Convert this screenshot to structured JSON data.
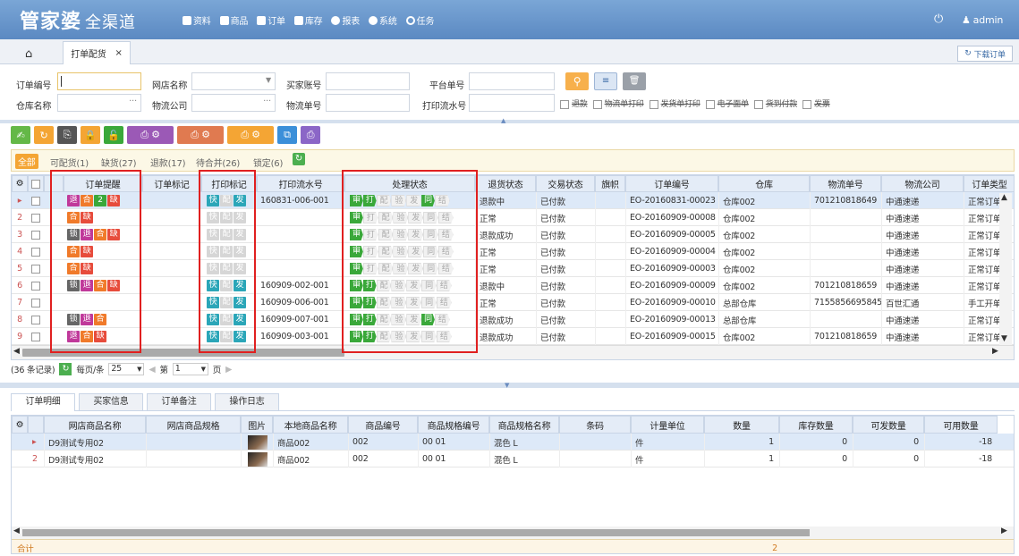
{
  "app": {
    "logo": "管家婆",
    "logo_sub": "全渠道",
    "nav": [
      "资料",
      "商品",
      "订单",
      "库存",
      "报表",
      "系统",
      "任务"
    ],
    "user": "admin"
  },
  "tabs": {
    "active": "打单配货",
    "download": "下载订单"
  },
  "search": {
    "order_no": "订单编号",
    "shop_name": "网店名称",
    "buyer": "买家账号",
    "platform_no": "平台单号",
    "warehouse": "仓库名称",
    "logistics_co": "物流公司",
    "logistics_no": "物流单号",
    "print_serial": "打印流水号",
    "options": [
      "退款",
      "物流单打印",
      "发货单打印",
      "电子面单",
      "货到付款",
      "发票"
    ]
  },
  "filters": [
    "全部",
    "可配货(1)",
    "缺货(27)",
    "退款(17)",
    "待合并(26)",
    "锁定(6)"
  ],
  "grid": {
    "columns": [
      "订单提醒",
      "订单标记",
      "打印标记",
      "打印流水号",
      "处理状态",
      "退货状态",
      "交易状态",
      "旗帜",
      "订单编号",
      "仓库",
      "物流单号",
      "物流公司",
      "订单类型"
    ],
    "steps": [
      "审",
      "打",
      "配",
      "验",
      "发",
      "同",
      "结"
    ],
    "rows": [
      {
        "n": "",
        "rem": [
          "退",
          "合",
          "2",
          "缺"
        ],
        "print": [
          1,
          0,
          1
        ],
        "serial": "160831-006-001",
        "steps": 6,
        "ret": "退款中",
        "trade": "已付款",
        "order": "EO-20160831-00023",
        "wh": "仓库002",
        "lno": "701210818649",
        "lco": "中通速递",
        "type": "正常订单"
      },
      {
        "n": "2",
        "rem": [
          "合",
          "缺"
        ],
        "print": [
          0,
          0,
          0
        ],
        "serial": "",
        "steps": 1,
        "ret": "正常",
        "trade": "已付款",
        "order": "EO-20160909-00008",
        "wh": "仓库002",
        "lno": "",
        "lco": "中通速递",
        "type": "正常订单"
      },
      {
        "n": "3",
        "rem": [
          "锁",
          "退",
          "合",
          "缺"
        ],
        "print": [
          0,
          0,
          0
        ],
        "serial": "",
        "steps": 1,
        "ret": "退款成功",
        "trade": "已付款",
        "order": "EO-20160909-00005",
        "wh": "仓库002",
        "lno": "",
        "lco": "中通速递",
        "type": "正常订单"
      },
      {
        "n": "4",
        "rem": [
          "合",
          "缺"
        ],
        "print": [
          0,
          0,
          0
        ],
        "serial": "",
        "steps": 1,
        "ret": "正常",
        "trade": "已付款",
        "order": "EO-20160909-00004",
        "wh": "仓库002",
        "lno": "",
        "lco": "中通速递",
        "type": "正常订单"
      },
      {
        "n": "5",
        "rem": [
          "合",
          "缺"
        ],
        "print": [
          0,
          0,
          0
        ],
        "serial": "",
        "steps": 1,
        "ret": "正常",
        "trade": "已付款",
        "order": "EO-20160909-00003",
        "wh": "仓库002",
        "lno": "",
        "lco": "中通速递",
        "type": "正常订单"
      },
      {
        "n": "6",
        "rem": [
          "锁",
          "退",
          "合",
          "缺"
        ],
        "print": [
          1,
          0,
          1
        ],
        "serial": "160909-002-001",
        "steps": 2,
        "ret": "退款中",
        "trade": "已付款",
        "order": "EO-20160909-00009",
        "wh": "仓库002",
        "lno": "701210818659",
        "lco": "中通速递",
        "type": "正常订单"
      },
      {
        "n": "7",
        "rem": [],
        "print": [
          1,
          0,
          1
        ],
        "serial": "160909-006-001",
        "steps": 2,
        "ret": "正常",
        "trade": "已付款",
        "order": "EO-20160909-00010",
        "wh": "总部仓库",
        "lno": "7155856695845",
        "lco": "百世汇通",
        "type": "手工开单"
      },
      {
        "n": "8",
        "rem": [
          "锁",
          "退",
          "合"
        ],
        "print": [
          1,
          0,
          1
        ],
        "serial": "160909-007-001",
        "steps": 6,
        "ret": "退款成功",
        "trade": "已付款",
        "order": "EO-20160909-00013",
        "wh": "总部仓库",
        "lno": "",
        "lco": "中通速递",
        "type": "正常订单"
      },
      {
        "n": "9",
        "rem": [
          "退",
          "合",
          "缺"
        ],
        "print": [
          1,
          0,
          1
        ],
        "serial": "160909-003-001",
        "steps": 2,
        "ret": "退款成功",
        "trade": "已付款",
        "order": "EO-20160909-00015",
        "wh": "仓库002",
        "lno": "701210818659",
        "lco": "中通速递",
        "type": "正常订单"
      }
    ],
    "print_labels": [
      "快",
      "配",
      "发"
    ]
  },
  "pager": {
    "records": "(36 条记录)",
    "per_page_label": "每页/条",
    "per_page": "25",
    "page_label": "第",
    "page": "1",
    "page_unit": "页"
  },
  "detail": {
    "tabs": [
      "订单明细",
      "买家信息",
      "订单备注",
      "操作日志"
    ],
    "columns": [
      "网店商品名称",
      "网店商品规格",
      "图片",
      "本地商品名称",
      "商品编号",
      "商品规格编号",
      "商品规格名称",
      "条码",
      "计量单位",
      "数量",
      "库存数量",
      "可发数量",
      "可用数量"
    ],
    "rows": [
      {
        "n": "",
        "name": "D9测试专用02",
        "local": "商品002",
        "code": "002",
        "spec_code": "00 01",
        "spec": "混色 L",
        "unit": "件",
        "qty": "1",
        "stock": "0",
        "avail": "0",
        "usable": "-18"
      },
      {
        "n": "2",
        "name": "D9测试专用02",
        "local": "商品002",
        "code": "002",
        "spec_code": "00 01",
        "spec": "混色 L",
        "unit": "件",
        "qty": "1",
        "stock": "0",
        "avail": "0",
        "usable": "-18"
      }
    ],
    "total_label": "合计",
    "total_qty": "2"
  }
}
